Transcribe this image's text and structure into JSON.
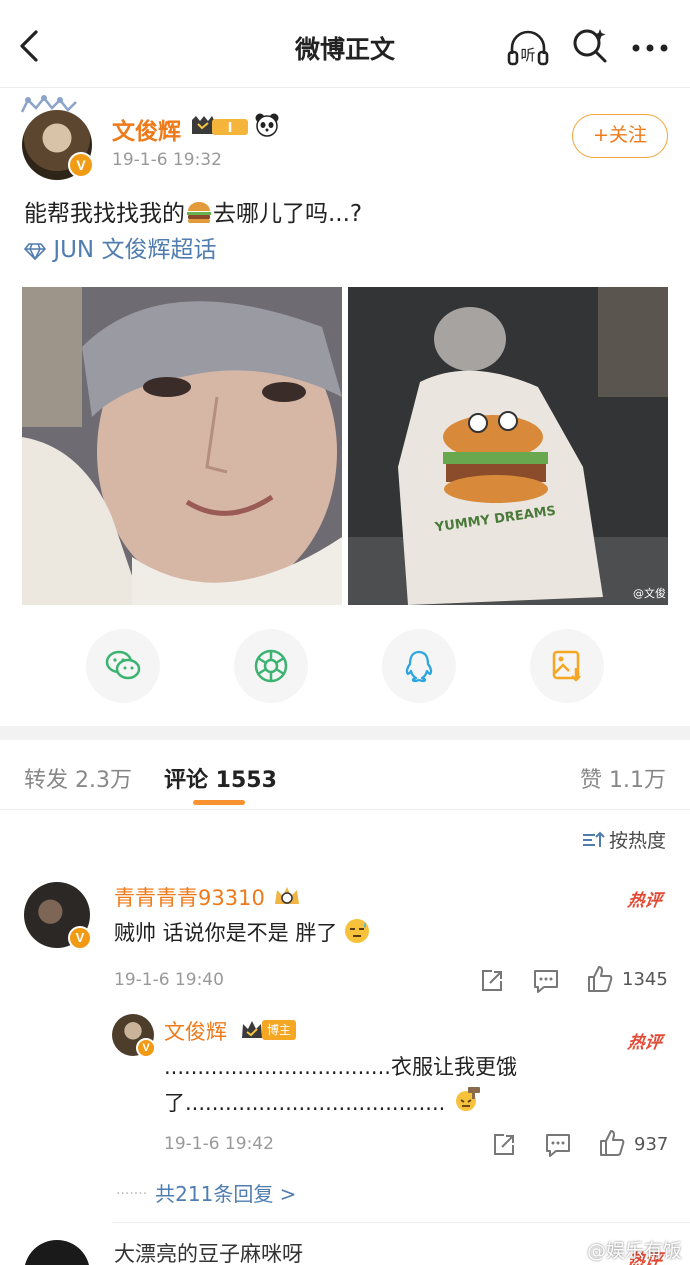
{
  "nav": {
    "title": "微博正文",
    "listen_label": "听"
  },
  "post": {
    "author": "文俊辉",
    "level": "I",
    "verified": "V",
    "time": "19-1-6 19:32",
    "follow_label": "+关注",
    "text_before": "能帮我找找我的",
    "emoji": "burger-emoji",
    "text_after": "去哪儿了吗...?",
    "topic": "JUN 文俊辉超话",
    "photo_watermark": "@文俊",
    "photo2_print": "YUMMY DREAMS"
  },
  "share": {
    "items": [
      "wechat-icon",
      "moments-icon",
      "qq-icon",
      "save-image-icon"
    ]
  },
  "tabs": {
    "repost": "转发 2.3万",
    "comment": "评论 1553",
    "like": "赞 1.1万"
  },
  "sort_label": "按热度",
  "comments": [
    {
      "name": "青青青青93310",
      "verified": "V",
      "text": "贼帅 话说你是不是 胖了",
      "time": "19-1-6 19:40",
      "hot": "热评",
      "likes": "1345"
    }
  ],
  "reply": {
    "name": "文俊辉",
    "badge": "博主",
    "verified": "V",
    "line1": "..................................衣服让我更饿",
    "line2": "了.......................................",
    "time": "19-1-6 19:42",
    "hot": "热评",
    "likes": "937"
  },
  "more_replies": "共211条回复 >",
  "next_comment": {
    "name": "大漂亮的豆子麻咪呀",
    "hot": "热评"
  },
  "watermark": "@娱乐有饭",
  "colors": {
    "accent": "#ee7a19",
    "link": "#507daf",
    "hot": "#e24b35"
  }
}
